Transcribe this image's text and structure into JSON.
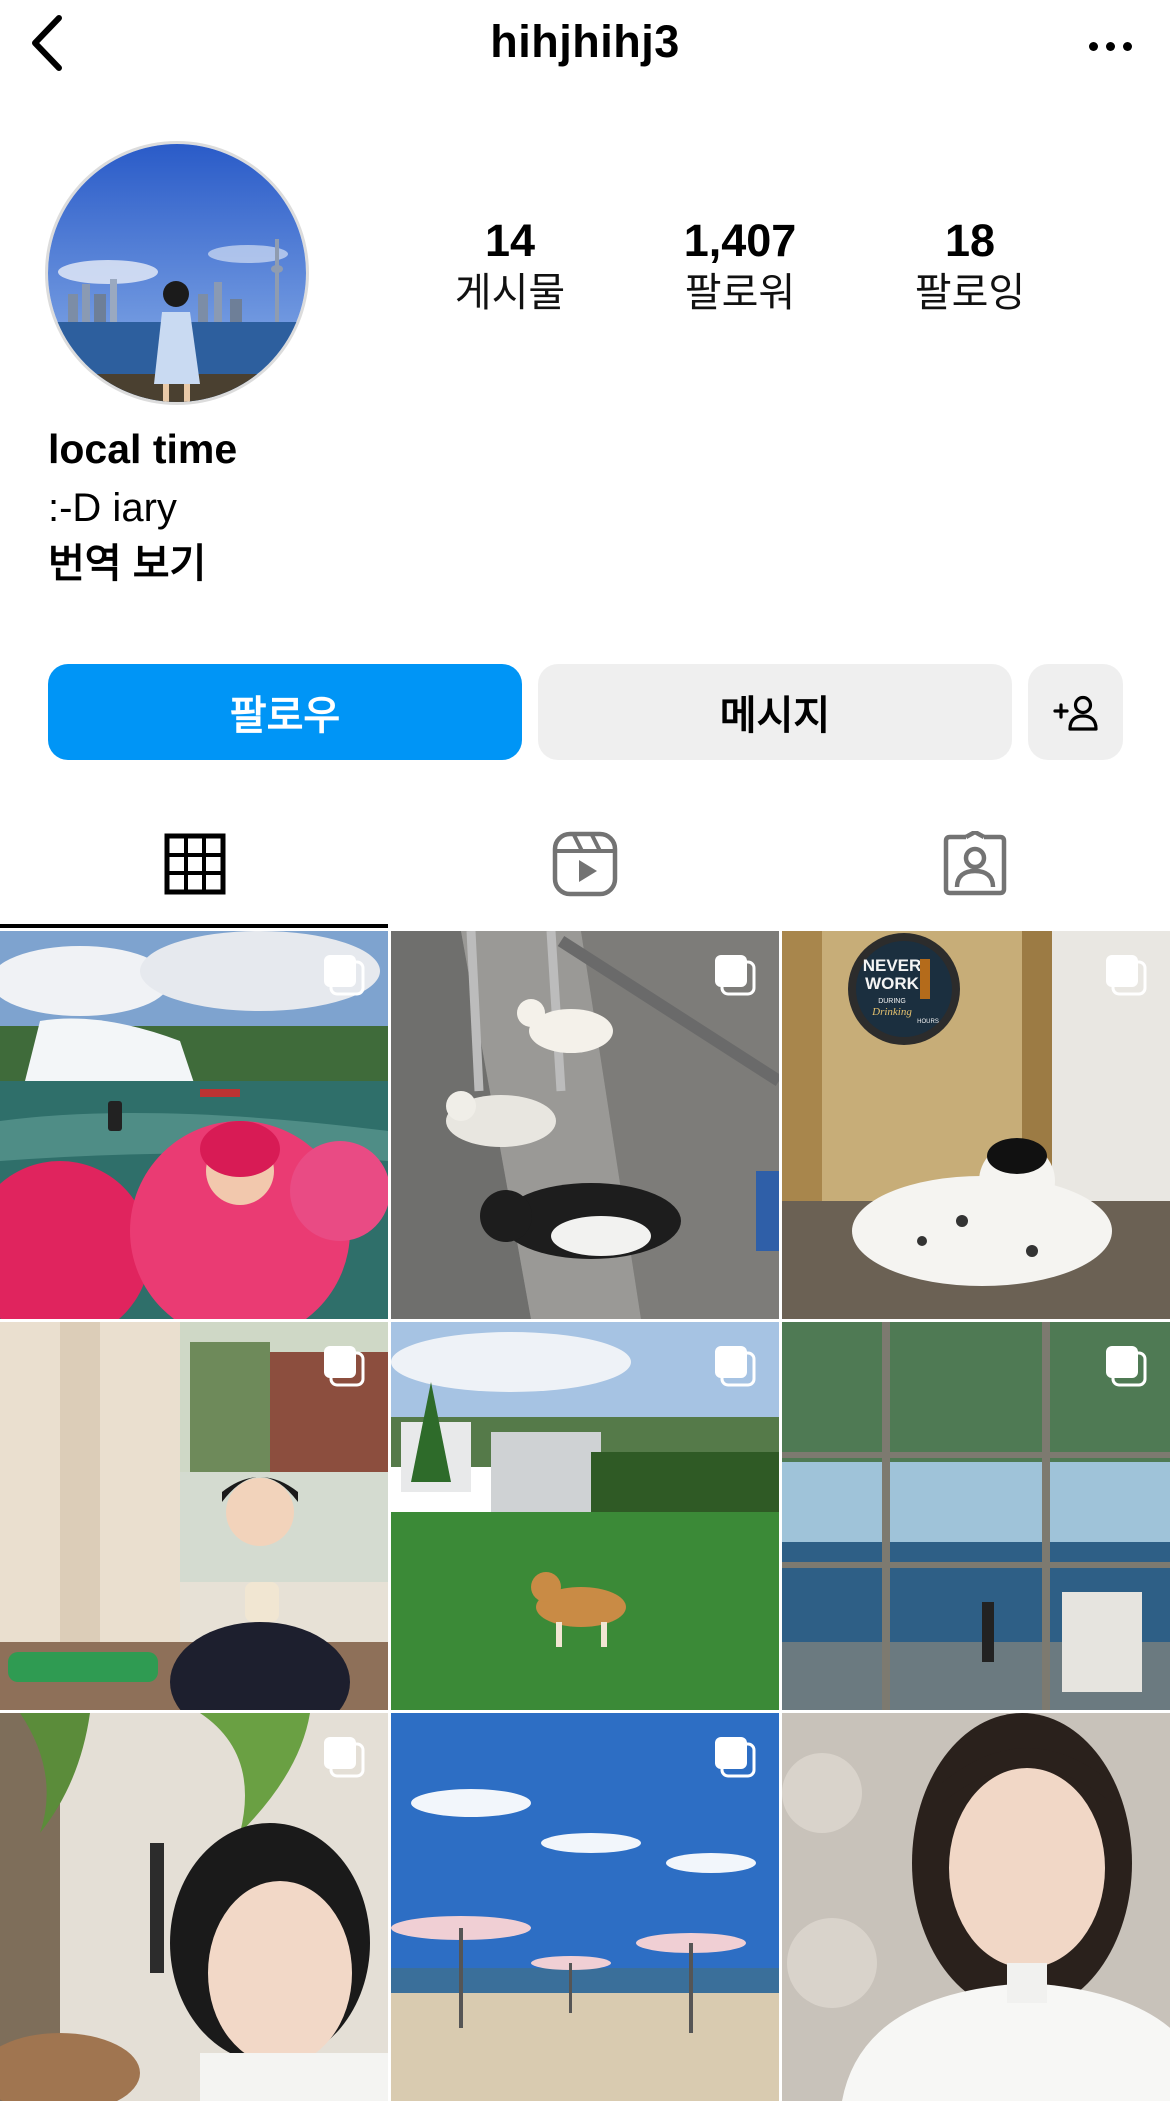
{
  "header": {
    "username": "hihjhihj3",
    "back_icon": "chevron-left-icon",
    "more_icon": "ellipsis-icon"
  },
  "profile": {
    "stats": [
      {
        "value": "14",
        "label": "게시물"
      },
      {
        "value": "1,407",
        "label": "팔로워"
      },
      {
        "value": "18",
        "label": "팔로잉"
      }
    ],
    "name": "local time",
    "bio": ":-D iary",
    "translate": "번역 보기"
  },
  "actions": {
    "follow": "팔로우",
    "message": "메시지",
    "suggest_icon": "add-person-icon"
  },
  "tabs": [
    {
      "name": "posts-grid",
      "icon": "grid-icon",
      "active": true
    },
    {
      "name": "reels",
      "icon": "reels-icon",
      "active": false
    },
    {
      "name": "tagged",
      "icon": "tagged-person-icon",
      "active": false
    }
  ],
  "colors": {
    "follow_button": "#0095f6",
    "secondary_button": "#efefef"
  },
  "posts": [
    {
      "subject": "waterfall-boat-selfie",
      "multiple": true
    },
    {
      "subject": "cats-on-steps",
      "multiple": true
    },
    {
      "subject": "dog-under-sign",
      "multiple": true,
      "sign_text": [
        "NEVER",
        "WORK",
        "DURING",
        "Drinking",
        "HOURS"
      ]
    },
    {
      "subject": "person-at-window",
      "multiple": true
    },
    {
      "subject": "shiba-on-lawn",
      "multiple": true
    },
    {
      "subject": "window-reflection-lake",
      "multiple": true
    },
    {
      "subject": "person-with-plant",
      "multiple": true
    },
    {
      "subject": "beach-umbrellas",
      "multiple": true
    },
    {
      "subject": "portrait-white-blouse",
      "multiple": false
    }
  ]
}
